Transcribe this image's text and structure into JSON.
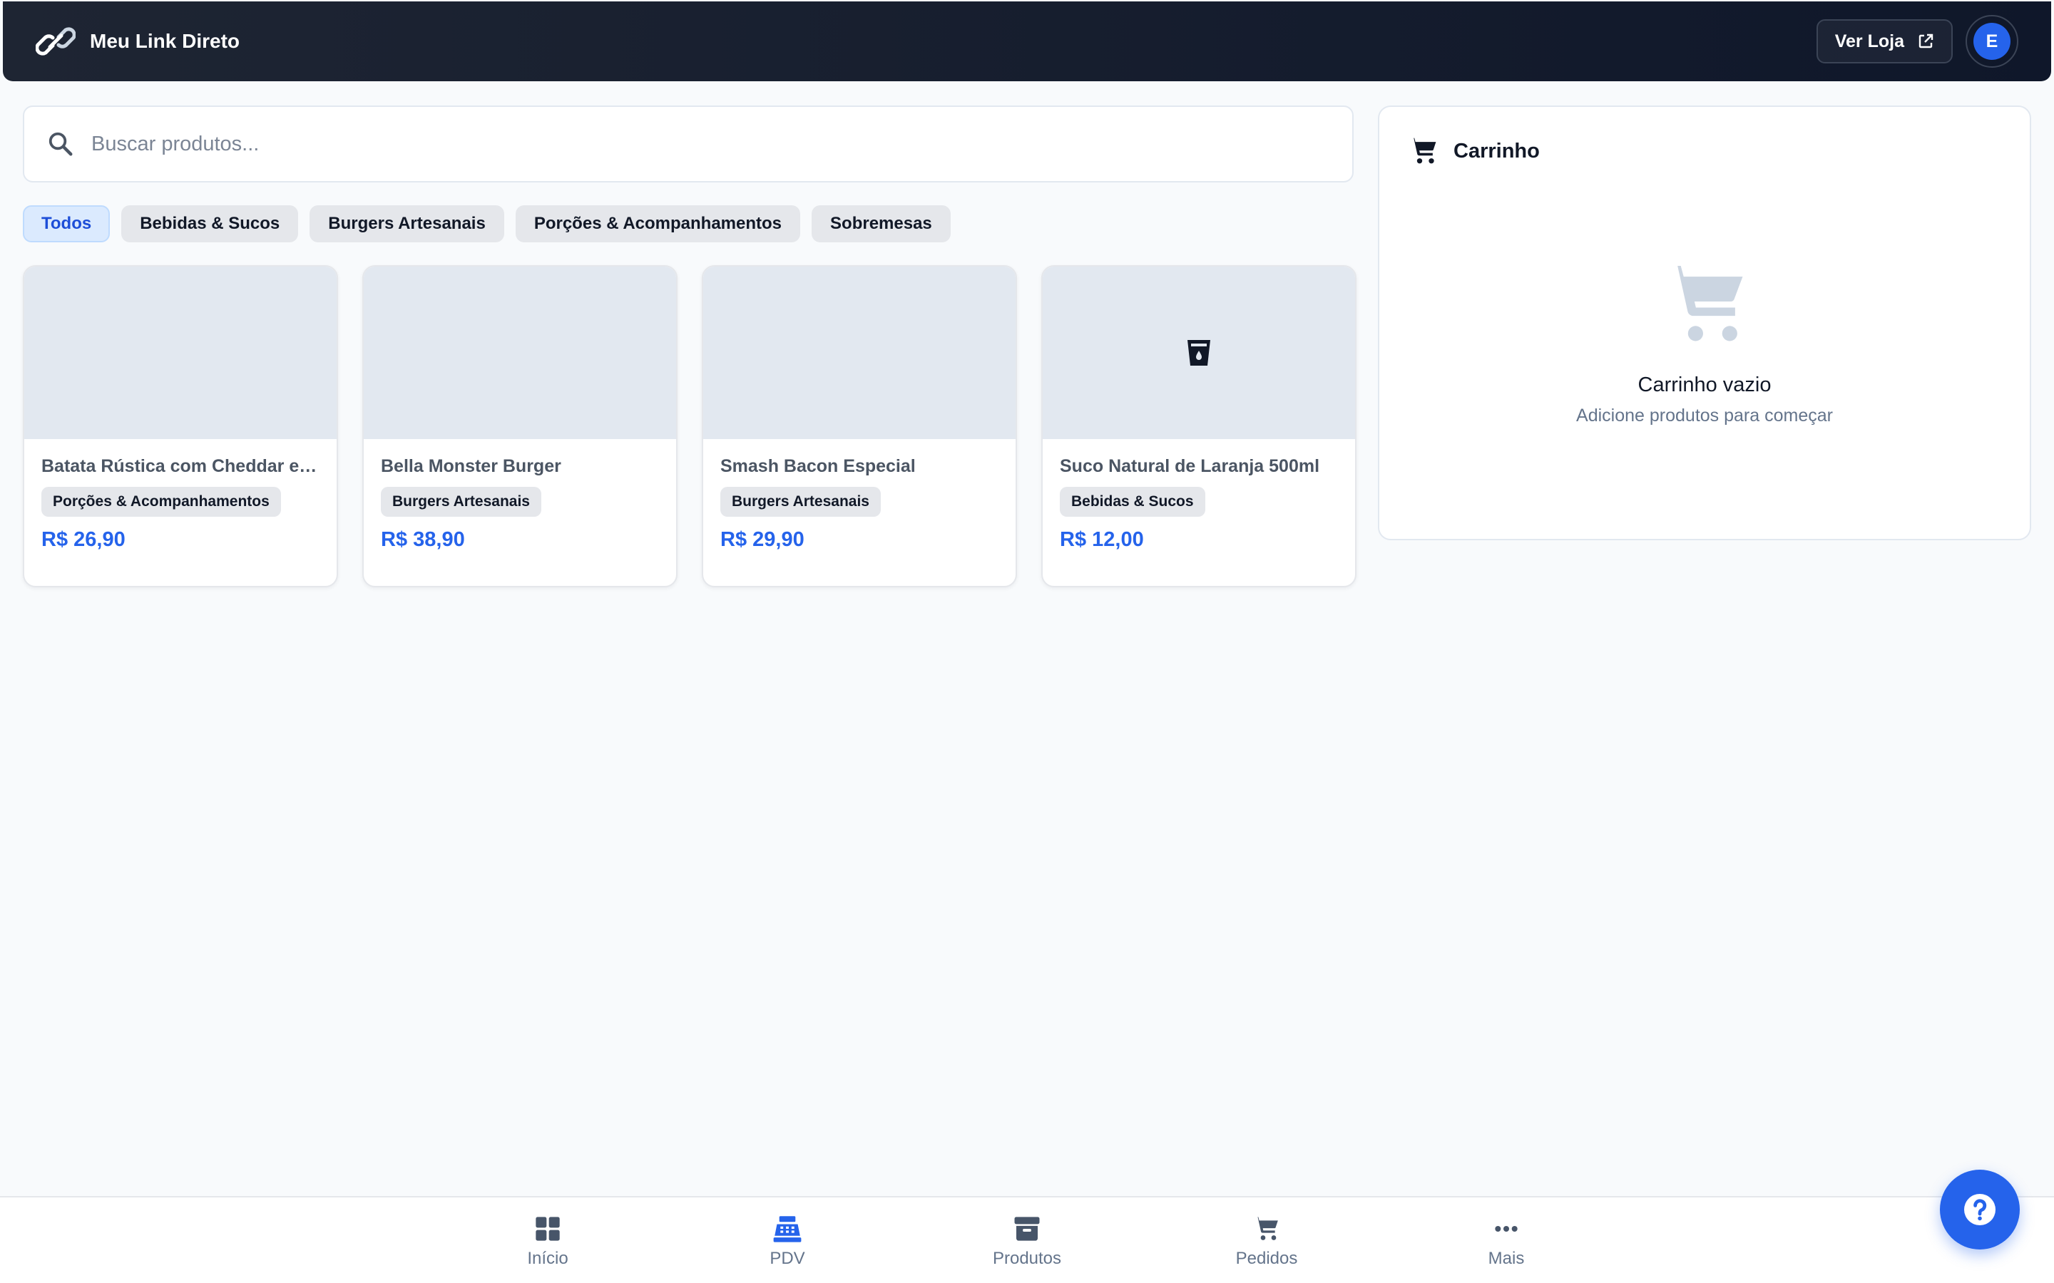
{
  "header": {
    "brand": "Meu Link Direto",
    "ver_loja_label": "Ver Loja",
    "avatar_initial": "E"
  },
  "search": {
    "placeholder": "Buscar produtos...",
    "value": ""
  },
  "categories": [
    {
      "label": "Todos",
      "active": true
    },
    {
      "label": "Bebidas & Sucos",
      "active": false
    },
    {
      "label": "Burgers Artesanais",
      "active": false
    },
    {
      "label": "Porções & Acompanhamentos",
      "active": false
    },
    {
      "label": "Sobremesas",
      "active": false
    }
  ],
  "products": [
    {
      "name": "Batata Rústica com Cheddar e Bacon",
      "category": "Porções & Acompanhamentos",
      "price": "R$ 26,90",
      "icon": ""
    },
    {
      "name": "Bella Monster Burger",
      "category": "Burgers Artesanais",
      "price": "R$ 38,90",
      "icon": ""
    },
    {
      "name": "Smash Bacon Especial",
      "category": "Burgers Artesanais",
      "price": "R$ 29,90",
      "icon": ""
    },
    {
      "name": "Suco Natural de Laranja 500ml",
      "category": "Bebidas & Sucos",
      "price": "R$ 12,00",
      "icon": "drink-cup-icon"
    }
  ],
  "cart": {
    "title": "Carrinho",
    "empty_title": "Carrinho vazio",
    "empty_subtitle": "Adicione produtos para começar"
  },
  "bottom_nav": [
    {
      "label": "Início",
      "icon": "grid-icon"
    },
    {
      "label": "PDV",
      "icon": "cash-register-icon",
      "active": true
    },
    {
      "label": "Produtos",
      "icon": "archive-box-icon"
    },
    {
      "label": "Pedidos",
      "icon": "cart-icon"
    },
    {
      "label": "Mais",
      "icon": "more-dots-icon"
    }
  ],
  "colors": {
    "accent": "#2563eb",
    "header_bg": "#0f172a",
    "chip_active_bg": "#dbeafe",
    "page_bg": "#f8fafc"
  }
}
